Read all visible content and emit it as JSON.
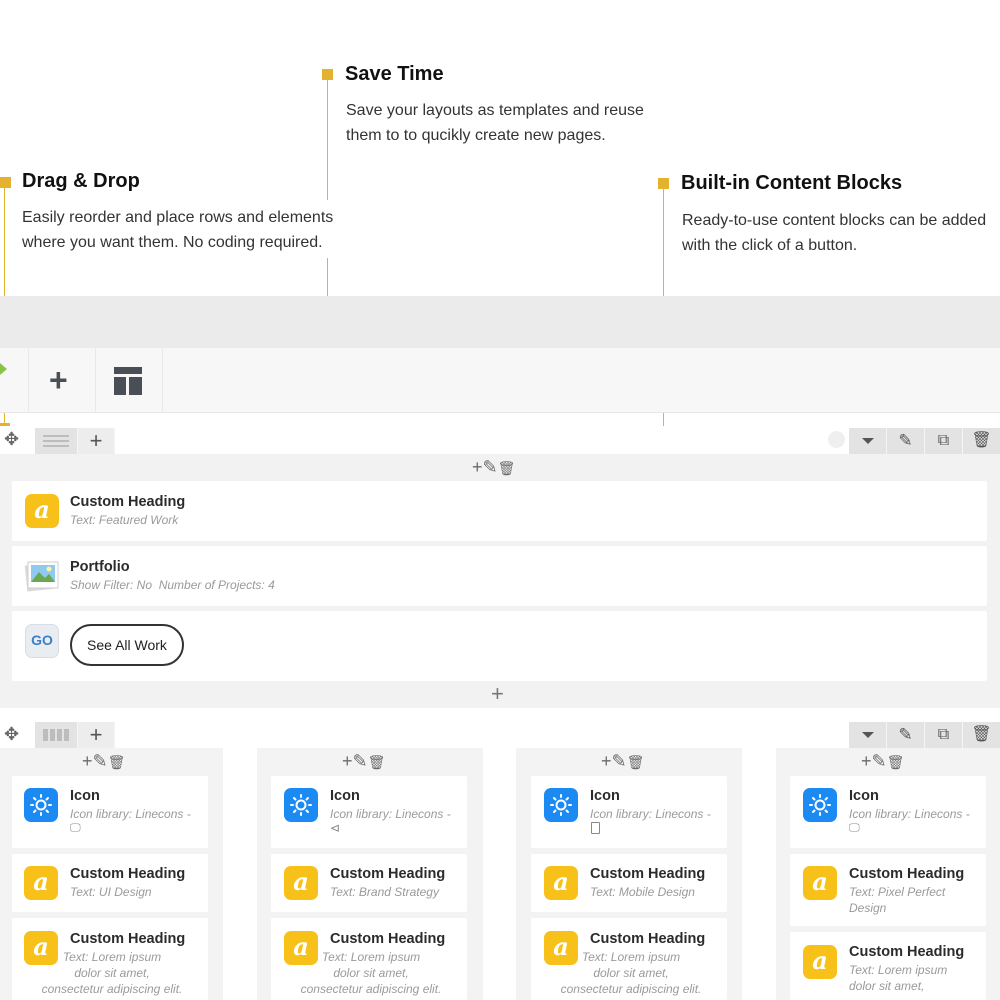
{
  "callouts": {
    "drag_drop": {
      "title": "Drag & Drop",
      "desc": "Easily reorder and place rows and elements\nwhere you want them. No coding required."
    },
    "save_time": {
      "title": "Save Time",
      "desc": "Save your layouts as templates and reuse\nthem to to qucikly create new pages."
    },
    "content_blocks": {
      "title": "Built-in Content Blocks",
      "desc": "Ready-to-use content blocks can be added\nwith the click of a button."
    }
  },
  "colors": {
    "accent": "#e4b22f",
    "heading_icon": "#f7c11a",
    "icon_blue": "#1b8af2"
  },
  "toolbar": {
    "add_icon": "plus-icon",
    "templates_icon": "templates-icon"
  },
  "row1": {
    "elements": [
      {
        "icon": "a",
        "title": "Custom Heading",
        "sub": "Text: Featured Work"
      },
      {
        "icon": "image",
        "title": "Portfolio",
        "sub": "Show Filter: No  Number of Projects: 4"
      }
    ],
    "go_label": "GO",
    "button_label": "See All Work"
  },
  "columns": [
    {
      "icon_title": "Icon",
      "icon_sub": "Icon library: Linecons -",
      "heading_title": "Custom Heading",
      "heading_sub": "Text: UI Design",
      "lorem_title": "Custom Heading",
      "lorem_sub": "Text: Lorem ipsum\ndolor sit amet,\nconsectetur adipiscing elit."
    },
    {
      "icon_title": "Icon",
      "icon_sub": "Icon library: Linecons -",
      "heading_title": "Custom Heading",
      "heading_sub": "Text: Brand Strategy",
      "lorem_title": "Custom Heading",
      "lorem_sub": "Text: Lorem ipsum\ndolor sit amet,\nconsectetur adipiscing elit."
    },
    {
      "icon_title": "Icon",
      "icon_sub": "Icon library: Linecons -",
      "heading_title": "Custom Heading",
      "heading_sub": "Text: Mobile Design",
      "lorem_title": "Custom Heading",
      "lorem_sub": "Text: Lorem ipsum\ndolor sit amet,\nconsectetur adipiscing elit."
    },
    {
      "icon_title": "Icon",
      "icon_sub": "Icon library: Linecons -",
      "heading_title": "Custom Heading",
      "heading_sub": "Text: Pixel Perfect\nDesign",
      "lorem_title": "Custom Heading",
      "lorem_sub": "Text: Lorem ipsum\ndolor sit amet,"
    }
  ]
}
